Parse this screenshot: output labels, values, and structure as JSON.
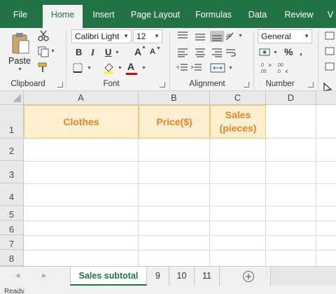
{
  "ribbon_tabs": [
    "File",
    "Home",
    "Insert",
    "Page Layout",
    "Formulas",
    "Data",
    "Review",
    "V"
  ],
  "active_tab": "Home",
  "clipboard": {
    "paste_label": "Paste",
    "group_label": "Clipboard"
  },
  "font": {
    "name": "Calibri Light",
    "size": "12",
    "group_label": "Font",
    "bold": "B",
    "italic": "I",
    "underline": "U",
    "grow": "A",
    "shrink": "A",
    "font_color": "A"
  },
  "alignment": {
    "group_label": "Alignment"
  },
  "number": {
    "format": "General",
    "group_label": "Number",
    "percent": "%"
  },
  "columns": [
    "A",
    "B",
    "C",
    "D"
  ],
  "rows": [
    "1",
    "2",
    "3",
    "4",
    "5",
    "6",
    "7",
    "8"
  ],
  "cells": {
    "A1": "Clothes",
    "B1": "Price($)",
    "C1_line1": "Sales",
    "C1_line2": "(pieces)"
  },
  "sheet_tabs": {
    "active": "Sales subtotal",
    "others": [
      "9",
      "10",
      "11"
    ]
  },
  "status": "Ready",
  "colors": {
    "accent": "#217346",
    "header_fill": "#fdefd0",
    "header_text": "#e8842a"
  }
}
